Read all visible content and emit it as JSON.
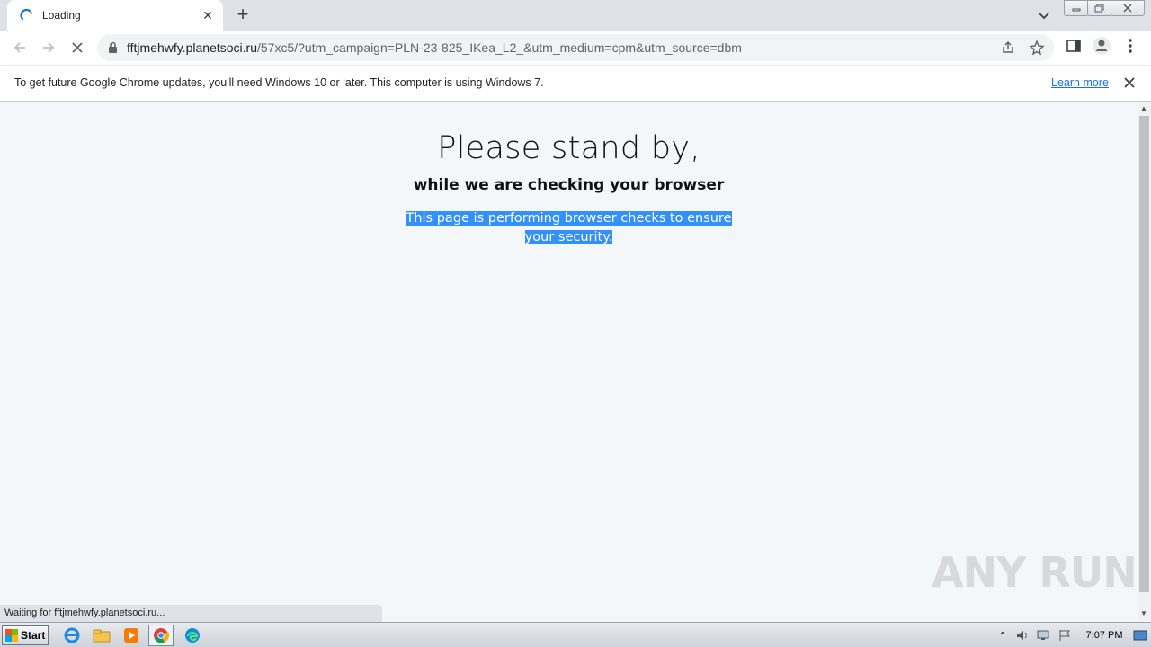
{
  "browser": {
    "tab": {
      "title": "Loading",
      "close_glyph": "✕"
    },
    "new_tab_glyph": "+",
    "url_host": "fftjmehwfy.planetsoci.ru",
    "url_rest": "/57xc5/?utm_campaign=PLN-23-825_IKea_L2_&utm_medium=cpm&utm_source=dbm"
  },
  "infobar": {
    "message": "To get future Google Chrome updates, you'll need Windows 10 or later. This computer is using Windows 7.",
    "learn_more": "Learn more"
  },
  "page": {
    "heading": "Please stand by,",
    "subheading": "while we are checking your browser",
    "selected_line1": "This page is performing browser checks to ensure",
    "selected_line2": "your security."
  },
  "status_text": "Waiting for fftjmehwfy.planetsoci.ru...",
  "watermark": "ANY RUN",
  "taskbar": {
    "start_label": "Start",
    "clock": "7:07 PM",
    "apps": [
      "ie-icon",
      "explorer-icon",
      "media-player-icon",
      "chrome-icon",
      "edge-icon"
    ]
  },
  "colors": {
    "selection": "#3390ff",
    "link": "#1a73e8",
    "tabstrip": "#dee1e6",
    "page_bg": "#f4f7fa"
  }
}
